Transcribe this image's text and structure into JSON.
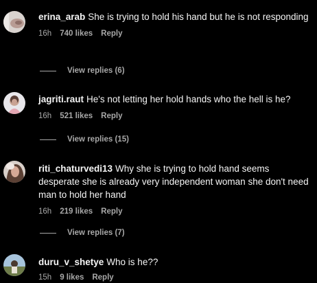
{
  "comments": [
    {
      "username": "erina_arab",
      "text": "She is trying to hold his hand but he is not responding",
      "time": "16h",
      "likes": "740 likes",
      "reply": "Reply",
      "view_replies": "View replies (6)"
    },
    {
      "username": "jagriti.raut",
      "text": "He's not letting her hold hands who the hell is he?",
      "time": "16h",
      "likes": "521 likes",
      "reply": "Reply",
      "view_replies": "View replies (15)"
    },
    {
      "username": "riti_chaturvedi13",
      "text": "Why she is trying to hold hand seems desperate she is already very independent woman she don't need man to hold her hand",
      "time": "16h",
      "likes": "219 likes",
      "reply": "Reply",
      "view_replies": "View replies (7)"
    },
    {
      "username": "duru_v_shetye",
      "text": "Who is he??",
      "time": "15h",
      "likes": "9 likes",
      "reply": "Reply"
    }
  ],
  "colors": {
    "background": "#000000",
    "text": "#f5f5f5",
    "muted": "#a8a8a8"
  }
}
